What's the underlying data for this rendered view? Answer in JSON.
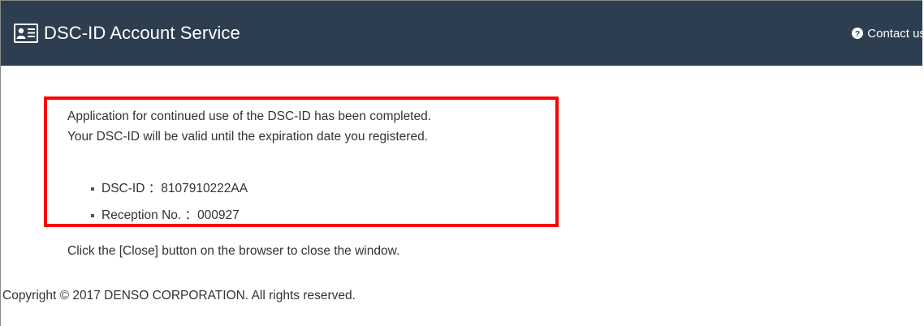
{
  "header": {
    "title": "DSC-ID Account Service",
    "brand_icon": "id-card-icon",
    "contact_label": "Contact us",
    "contact_icon": "question-circle-icon",
    "background_color": "#2c3e50"
  },
  "message": {
    "line1": "Application for continued use of the DSC-ID has been completed.",
    "line2": "Your DSC-ID will be valid until the expiration date you registered."
  },
  "details": [
    {
      "label": "DSC-ID",
      "separator": "：",
      "value": "8107910222AA"
    },
    {
      "label": "Reception No.",
      "separator": "：",
      "value": "000927"
    }
  ],
  "highlight_color": "#ff0000",
  "close_instruction": "Click the [Close] button on the browser to close the window.",
  "footer": {
    "copyright": "Copyright © 2017 DENSO CORPORATION. All rights reserved."
  }
}
